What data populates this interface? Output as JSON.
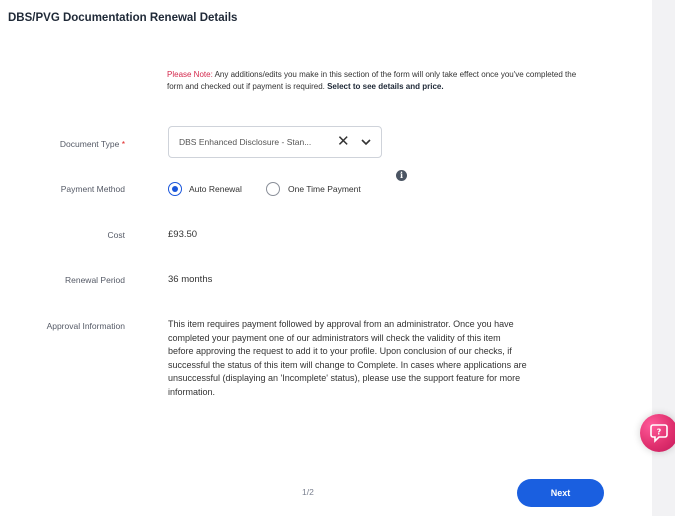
{
  "page_title": "DBS/PVG Documentation Renewal Details",
  "note": {
    "prefix": "Please Note:",
    "body": " Any additions/edits you make in this section of the form will only take effect once you've completed the form and checked out if payment is required. ",
    "bold": "Select to see details and price."
  },
  "document_type": {
    "label": "Document Type",
    "required_mark": "*",
    "value": "DBS Enhanced Disclosure - Stan...",
    "clear_icon": "close-icon",
    "dropdown_icon": "chevron-down-icon"
  },
  "payment_method": {
    "label": "Payment Method",
    "options": [
      {
        "label": "Auto Renewal",
        "selected": true
      },
      {
        "label": "One Time Payment",
        "selected": false
      }
    ],
    "info_icon": "info-icon"
  },
  "cost": {
    "label": "Cost",
    "value": "£93.50"
  },
  "renewal_period": {
    "label": "Renewal Period",
    "value": "36 months"
  },
  "approval": {
    "label": "Approval Information",
    "text": "This item requires payment followed by approval from an administrator. Once you have completed your payment one of our administrators will check the validity of this item before approving the request to add it to your profile. Upon conclusion of our checks, if successful the status of this item will change to Complete. In cases where applications are unsuccessful (displaying an 'Incomplete' status), please use the support feature for more information."
  },
  "pagination": "1/2",
  "next_button": "Next",
  "help_button_icon": "question-chat-icon",
  "colors": {
    "accent": "#1a5fe0",
    "note_red": "#d4284c",
    "help_fab": "#e0306e"
  }
}
